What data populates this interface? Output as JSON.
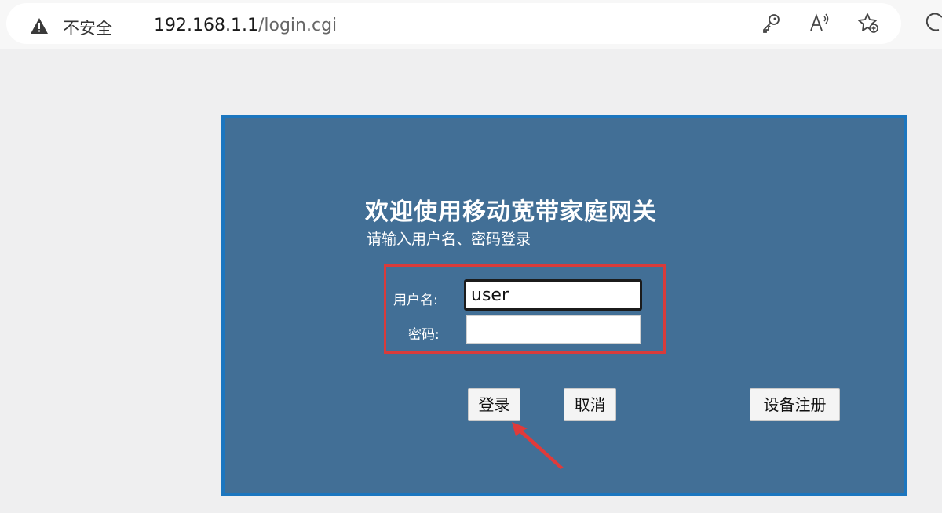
{
  "browser": {
    "security_label": "不安全",
    "url_host": "192.168.1.1",
    "url_path": "/login.cgi",
    "icons": [
      "warning-icon",
      "key-icon",
      "read-aloud-icon",
      "favorite-star-icon",
      "edge-icon"
    ]
  },
  "login": {
    "title": "欢迎使用移动宽带家庭网关",
    "subtitle": "请输入用户名、密码登录",
    "username_label": "用户名:",
    "username_value": "user",
    "password_label": "密码:",
    "password_value": "",
    "login_button": "登录",
    "cancel_button": "取消",
    "register_button": "设备注册"
  },
  "colors": {
    "panel_bg": "#426f96",
    "panel_border": "#1c76bf",
    "highlight": "#d93b3b",
    "arrow": "#e03a3a"
  }
}
